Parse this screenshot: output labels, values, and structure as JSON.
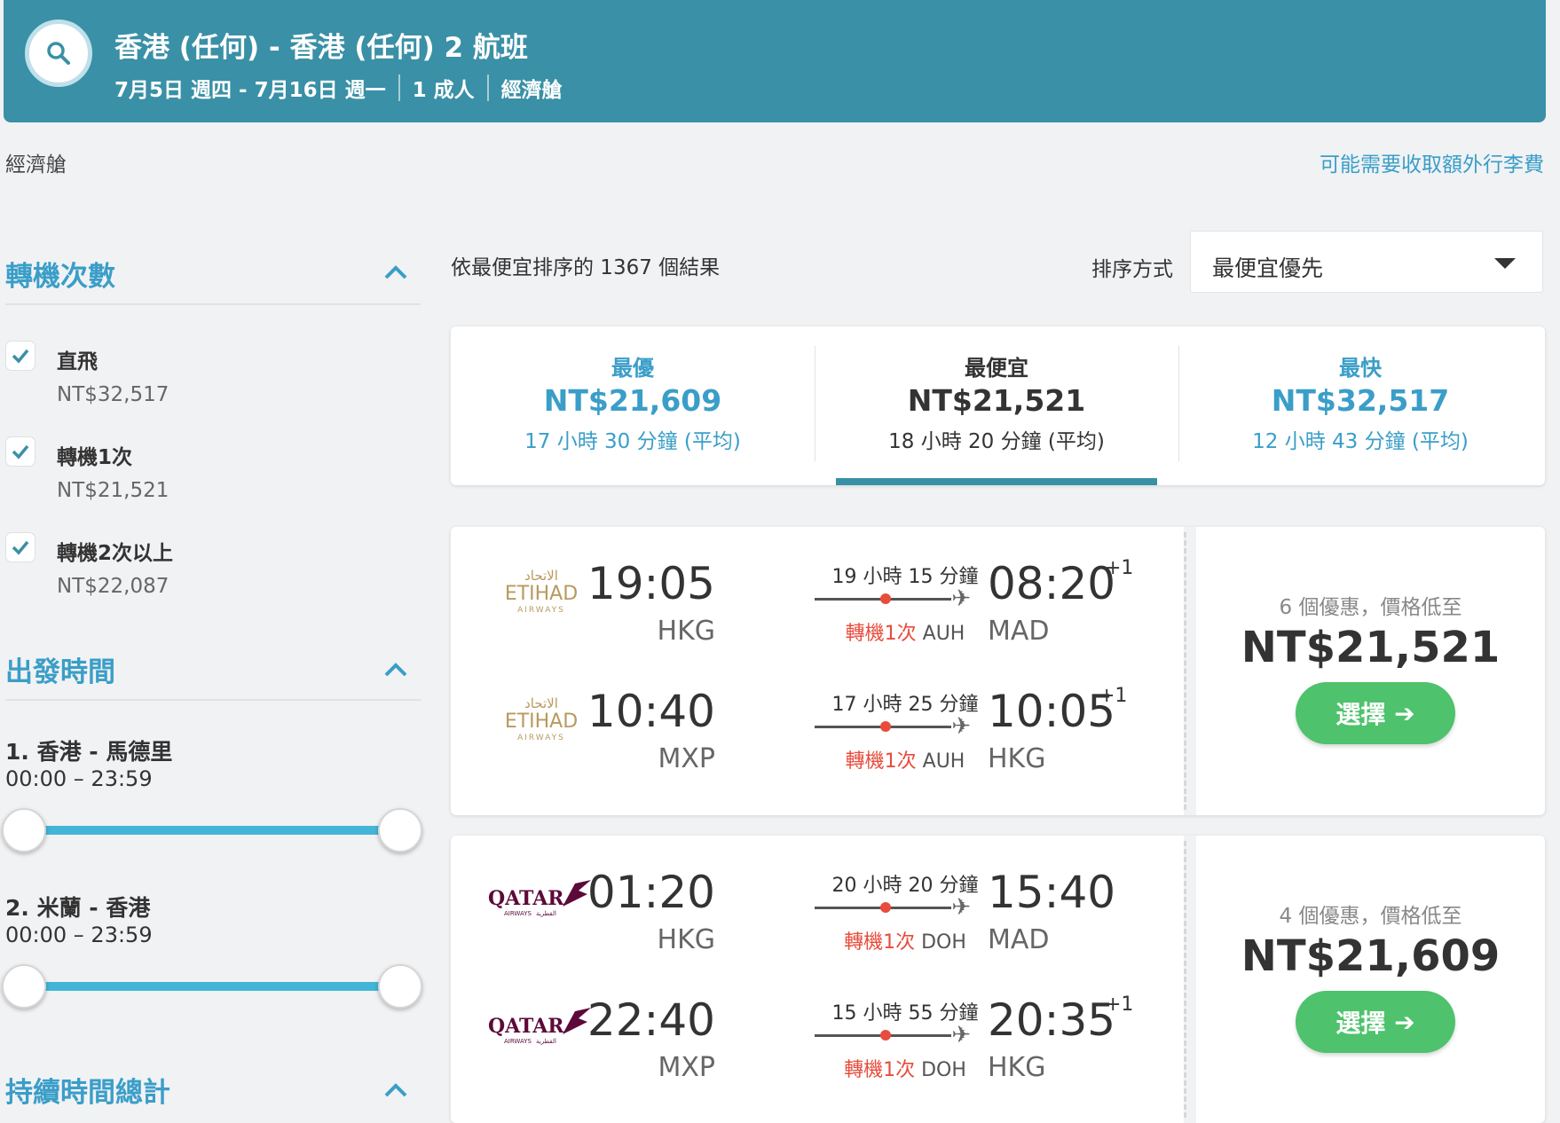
{
  "header": {
    "title": "香港 (任何) - 香港 (任何) 2 航班",
    "dates": "7月5日 週四 - 7月16日 週一",
    "passengers": "1 成人",
    "cabin": "經濟艙"
  },
  "cabin_label": "經濟艙",
  "baggage_notice": "可能需要收取額外行李費",
  "filters": {
    "stops": {
      "title": "轉機次數",
      "options": [
        {
          "label": "直飛",
          "price": "NT$32,517",
          "checked": true
        },
        {
          "label": "轉機1次",
          "price": "NT$21,521",
          "checked": true
        },
        {
          "label": "轉機2次以上",
          "price": "NT$22,087",
          "checked": true
        }
      ]
    },
    "departure": {
      "title": "出發時間",
      "routes": [
        {
          "label": "1. 香港 - 馬德里",
          "range": "00:00 – 23:59"
        },
        {
          "label": "2. 米蘭 - 香港",
          "range": "00:00 – 23:59"
        }
      ]
    },
    "duration": {
      "title": "持續時間總計"
    }
  },
  "results": {
    "count_text": "依最便宜排序的 1367 個結果",
    "sort_label": "排序方式",
    "sort_value": "最便宜優先"
  },
  "summary": [
    {
      "title": "最優",
      "price": "NT$21,609",
      "duration": "17 小時 30 分鐘 (平均)"
    },
    {
      "title": "最便宜",
      "price": "NT$21,521",
      "duration": "18 小時 20 分鐘 (平均)"
    },
    {
      "title": "最快",
      "price": "NT$32,517",
      "duration": "12 小時 43 分鐘 (平均)"
    }
  ],
  "flights": [
    {
      "airline": "Etihad Airways",
      "legs": [
        {
          "dep_time": "19:05",
          "dep_ap": "HKG",
          "duration": "19 小時 15 分鐘",
          "stop": "轉機1次",
          "via": "AUH",
          "arr_time": "08:20",
          "plus": "+1",
          "arr_ap": "MAD"
        },
        {
          "dep_time": "10:40",
          "dep_ap": "MXP",
          "duration": "17 小時 25 分鐘",
          "stop": "轉機1次",
          "via": "AUH",
          "arr_time": "10:05",
          "plus": "+1",
          "arr_ap": "HKG"
        }
      ],
      "deals": "6 個優惠，價格低至",
      "price": "NT$21,521",
      "button": "選擇"
    },
    {
      "airline": "Qatar Airways",
      "legs": [
        {
          "dep_time": "01:20",
          "dep_ap": "HKG",
          "duration": "20 小時 20 分鐘",
          "stop": "轉機1次",
          "via": "DOH",
          "arr_time": "15:40",
          "plus": "",
          "arr_ap": "MAD"
        },
        {
          "dep_time": "22:40",
          "dep_ap": "MXP",
          "duration": "15 小時 55 分鐘",
          "stop": "轉機1次",
          "via": "DOH",
          "arr_time": "20:35",
          "plus": "+1",
          "arr_ap": "HKG"
        }
      ],
      "deals": "4 個優惠，價格低至",
      "price": "NT$21,609",
      "button": "選擇"
    }
  ],
  "logos": {
    "etihad_arabic": "الاتحاد",
    "etihad_word": "ETIHAD",
    "etihad_sub": "AIRWAYS",
    "qatar_word": "QATAR",
    "qatar_sub": "AIRWAYS",
    "qatar_arabic": "القطرية"
  },
  "colors": {
    "header": "#3a90a6",
    "accent": "#3a9ec8",
    "button": "#4ec26c",
    "stop": "#e84c3d"
  }
}
